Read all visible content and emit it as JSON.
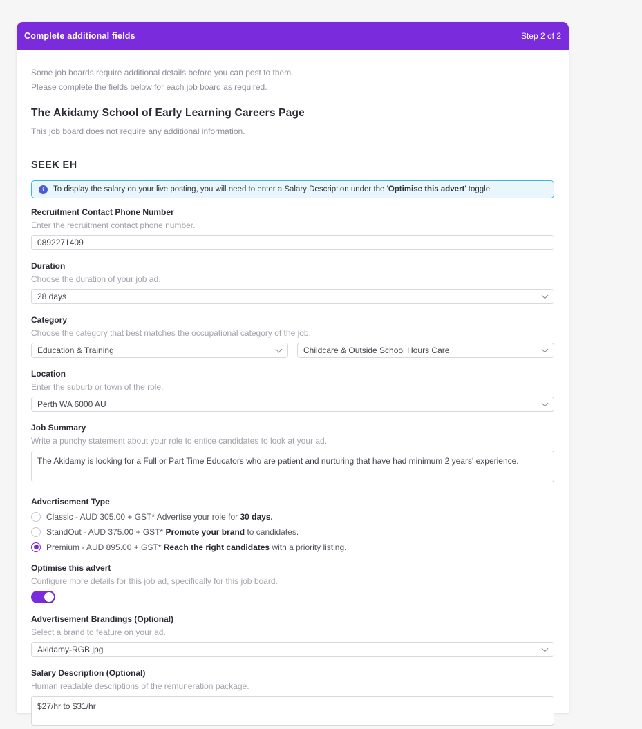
{
  "header": {
    "title": "Complete additional fields",
    "step_label": "Step 2 of 2",
    "accent_color": "#7a2bdb"
  },
  "intro": {
    "line1": "Some job boards require additional details before you can post to them.",
    "line2": "Please complete the fields below for each job board as required."
  },
  "careers_board": {
    "title": "The Akidamy School of Early Learning Careers Page",
    "note": "This job board does not require any additional information."
  },
  "seek": {
    "title": "SEEK EH",
    "banner": {
      "icon": "info-icon",
      "icon_glyph": "i",
      "pre": "To display the salary on your live posting, you will need to enter a Salary Description under the '",
      "bold": "Optimise this advert",
      "post": "' toggle",
      "border_color": "#38b6da",
      "bg_color": "#e9f7fc"
    },
    "phone": {
      "label": "Recruitment Contact Phone Number",
      "desc": "Enter the recruitment contact phone number.",
      "value": "0892271409"
    },
    "duration": {
      "label": "Duration",
      "desc": "Choose the duration of your job ad.",
      "value": "28 days"
    },
    "category": {
      "label": "Category",
      "desc": "Choose the category that best matches the occupational category of the job.",
      "value_primary": "Education & Training",
      "value_secondary": "Childcare & Outside School Hours Care"
    },
    "location": {
      "label": "Location",
      "desc": "Enter the suburb or town of the role.",
      "value": "Perth WA 6000 AU"
    },
    "job_summary": {
      "label": "Job Summary",
      "desc": "Write a punchy statement about your role to entice candidates to look at your ad.",
      "value": "The Akidamy is looking for a Full or Part Time Educators who are patient and nurturing that have had minimum 2 years' experience."
    },
    "ad_type": {
      "label": "Advertisement Type",
      "options": [
        {
          "pre": "Classic - AUD 305.00 + GST* Advertise your role for ",
          "bold": "30 days.",
          "post": "",
          "selected": false
        },
        {
          "pre": "StandOut - AUD 375.00 + GST* ",
          "bold": "Promote your brand",
          "post": " to candidates.",
          "selected": false
        },
        {
          "pre": "Premium - AUD 895.00 + GST* ",
          "bold": "Reach the right candidates",
          "post": " with a priority listing.",
          "selected": true
        }
      ]
    },
    "optimise": {
      "label": "Optimise this advert",
      "desc": "Configure more details for this job ad, specifically for this job board.",
      "toggle_on": true
    },
    "brandings": {
      "label": "Advertisement Brandings (Optional)",
      "desc": "Select a brand to feature on your ad.",
      "value": "Akidamy-RGB.jpg"
    },
    "salary": {
      "label": "Salary Description (Optional)",
      "desc": "Human readable descriptions of the remuneration package.",
      "value": "$27/hr to $31/hr"
    }
  }
}
